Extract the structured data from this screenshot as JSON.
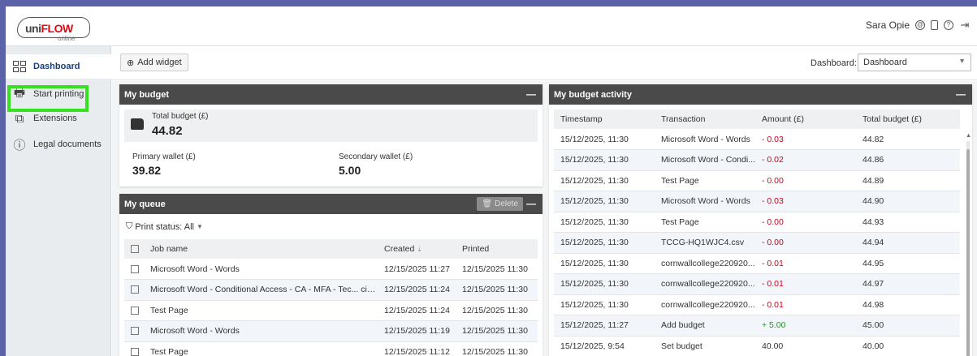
{
  "app": {
    "logo_uni": "uni",
    "logo_flow": "FLOW",
    "logo_sub": "online"
  },
  "topbar": {
    "user_name": "Sara Opie"
  },
  "sidebar": {
    "items": [
      {
        "label": "Dashboard",
        "icon": "dashboard-grid-icon"
      },
      {
        "label": "Start printing",
        "icon": "printer-icon"
      },
      {
        "label": "Extensions",
        "icon": "extensions-icon"
      },
      {
        "label": "Legal documents",
        "icon": "info-icon"
      }
    ]
  },
  "toolbar": {
    "add_widget": "Add widget",
    "dashboard_label": "Dashboard:",
    "dashboard_value": "Dashboard"
  },
  "my_budget": {
    "title": "My budget",
    "total_label": "Total budget (£)",
    "total_value": "44.82",
    "primary_label": "Primary wallet (£)",
    "primary_value": "39.82",
    "secondary_label": "Secondary wallet (£)",
    "secondary_value": "5.00"
  },
  "my_queue": {
    "title": "My queue",
    "delete_label": "Delete",
    "filter_label": "Print status: All",
    "columns": [
      "Job name",
      "Created",
      "Printed"
    ],
    "rows": [
      [
        "Microsoft Word - Words",
        "12/15/2025 11:27",
        "12/15/2025 11:30"
      ],
      [
        "Microsoft Word - Conditional Access - CA - MFA - Tec... cian Guide",
        "12/15/2025 11:24",
        "12/15/2025 11:30"
      ],
      [
        "Test Page",
        "12/15/2025 11:24",
        "12/15/2025 11:30"
      ],
      [
        "Microsoft Word - Words",
        "12/15/2025 11:19",
        "12/15/2025 11:30"
      ],
      [
        "Test Page",
        "12/15/2025 11:12",
        "12/15/2025 11:30"
      ]
    ]
  },
  "budget_activity": {
    "title": "My budget activity",
    "columns": [
      "Timestamp",
      "Transaction",
      "Amount (£)",
      "Total budget (£)"
    ],
    "rows": [
      [
        "15/12/2025, 11:30",
        "Microsoft Word - Words",
        "- 0.03",
        "44.82"
      ],
      [
        "15/12/2025, 11:30",
        "Microsoft Word - Condi...",
        "- 0.02",
        "44.86"
      ],
      [
        "15/12/2025, 11:30",
        "Test Page",
        "- 0.00",
        "44.89"
      ],
      [
        "15/12/2025, 11:30",
        "Microsoft Word - Words",
        "- 0.03",
        "44.90"
      ],
      [
        "15/12/2025, 11:30",
        "Test Page",
        "- 0.00",
        "44.93"
      ],
      [
        "15/12/2025, 11:30",
        "TCCG-HQ1WJC4.csv",
        "- 0.00",
        "44.94"
      ],
      [
        "15/12/2025, 11:30",
        "cornwallcollege220920...",
        "- 0.01",
        "44.95"
      ],
      [
        "15/12/2025, 11:30",
        "cornwallcollege220920...",
        "- 0.01",
        "44.97"
      ],
      [
        "15/12/2025, 11:30",
        "cornwallcollege220920...",
        "- 0.01",
        "44.98"
      ],
      [
        "15/12/2025, 11:27",
        "Add budget",
        "+ 5.00",
        "45.00"
      ],
      [
        "15/12/2025, 9:54",
        "Set budget",
        "40.00",
        "40.00"
      ]
    ]
  }
}
